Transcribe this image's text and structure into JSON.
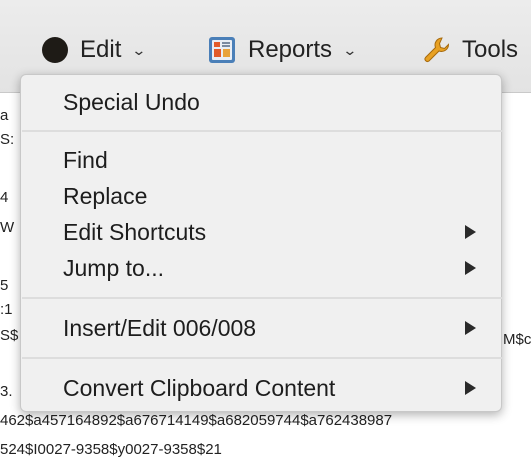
{
  "toolbar": {
    "edit_label": "Edit",
    "reports_label": "Reports",
    "tools_label": "Tools",
    "edit_icon": "edit-dot-icon",
    "reports_icon": "reports-icon",
    "tools_icon": "wrench-icon",
    "chevron": "⌄"
  },
  "menu": {
    "items": [
      {
        "label": "Special Undo",
        "submenu": false
      },
      {
        "label": "Find",
        "submenu": false
      },
      {
        "label": "Replace",
        "submenu": false
      },
      {
        "label": "Edit Shortcuts",
        "submenu": true
      },
      {
        "label": "Jump to...",
        "submenu": true
      },
      {
        "label": "Insert/Edit 006/008",
        "submenu": true
      },
      {
        "label": "Convert Clipboard Content",
        "submenu": true
      }
    ]
  },
  "background": {
    "left_fragments": [
      "a",
      "S:",
      "4",
      "W",
      "5",
      ":1",
      "S$",
      "3."
    ],
    "right_fragment": "M$c",
    "line1": "462$a457164892$a676714149$a682059744$a762438987",
    "line2": "524$I0027-9358$y0027-9358$21"
  }
}
